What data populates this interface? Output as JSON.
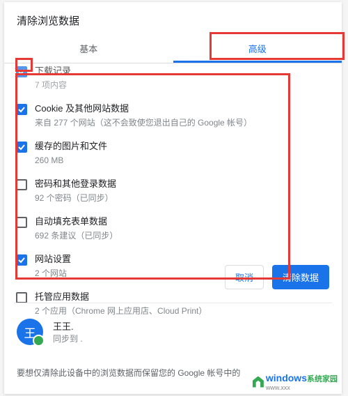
{
  "dialog": {
    "title": "清除浏览数据"
  },
  "tabs": {
    "basic": "基本",
    "advanced": "高级"
  },
  "items": [
    {
      "checked": true,
      "title": "下载记录",
      "sub": "7 项内容"
    },
    {
      "checked": true,
      "title": "Cookie 及其他网站数据",
      "sub": "来自 277 个网站（这不会致使您退出自己的 Google 帐号）"
    },
    {
      "checked": true,
      "title": "缓存的图片和文件",
      "sub": "260 MB"
    },
    {
      "checked": false,
      "title": "密码和其他登录数据",
      "sub": "92 个密码（已同步）"
    },
    {
      "checked": false,
      "title": "自动填充表单数据",
      "sub": "692 条建议（已同步）"
    },
    {
      "checked": true,
      "title": "网站设置",
      "sub": "2 个网站"
    },
    {
      "checked": false,
      "title": "托管应用数据",
      "sub": "2 个应用（Chrome 网上应用店、Cloud Print）"
    }
  ],
  "buttons": {
    "cancel": "取消",
    "clear": "清除数据"
  },
  "account": {
    "avatar_letter": "王",
    "name": "王王.",
    "sub": "同步到 ."
  },
  "footer": {
    "text": "要想仅清除此设备中的浏览数据而保留您的 Google 帐号中的"
  },
  "watermark": {
    "brand": "windows",
    "tag": "系统家园",
    "url": "www.xxx"
  }
}
